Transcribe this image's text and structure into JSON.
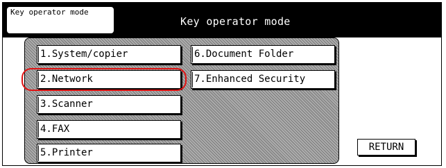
{
  "header": {
    "tab_label": "Key operator mode",
    "title": "Key operator mode"
  },
  "menu": {
    "items": [
      {
        "label": "1.System/copier"
      },
      {
        "label": "2.Network"
      },
      {
        "label": "3.Scanner"
      },
      {
        "label": "4.FAX"
      },
      {
        "label": "5.Printer"
      },
      {
        "label": "6.Document Folder"
      },
      {
        "label": "7.Enhanced Security"
      }
    ],
    "highlighted_item": "2.Network"
  },
  "footer": {
    "return_label": "RETURN"
  },
  "colors": {
    "header_bg": "#000000",
    "panel_bg": "#9c9c9c",
    "highlight": "#e11212"
  }
}
